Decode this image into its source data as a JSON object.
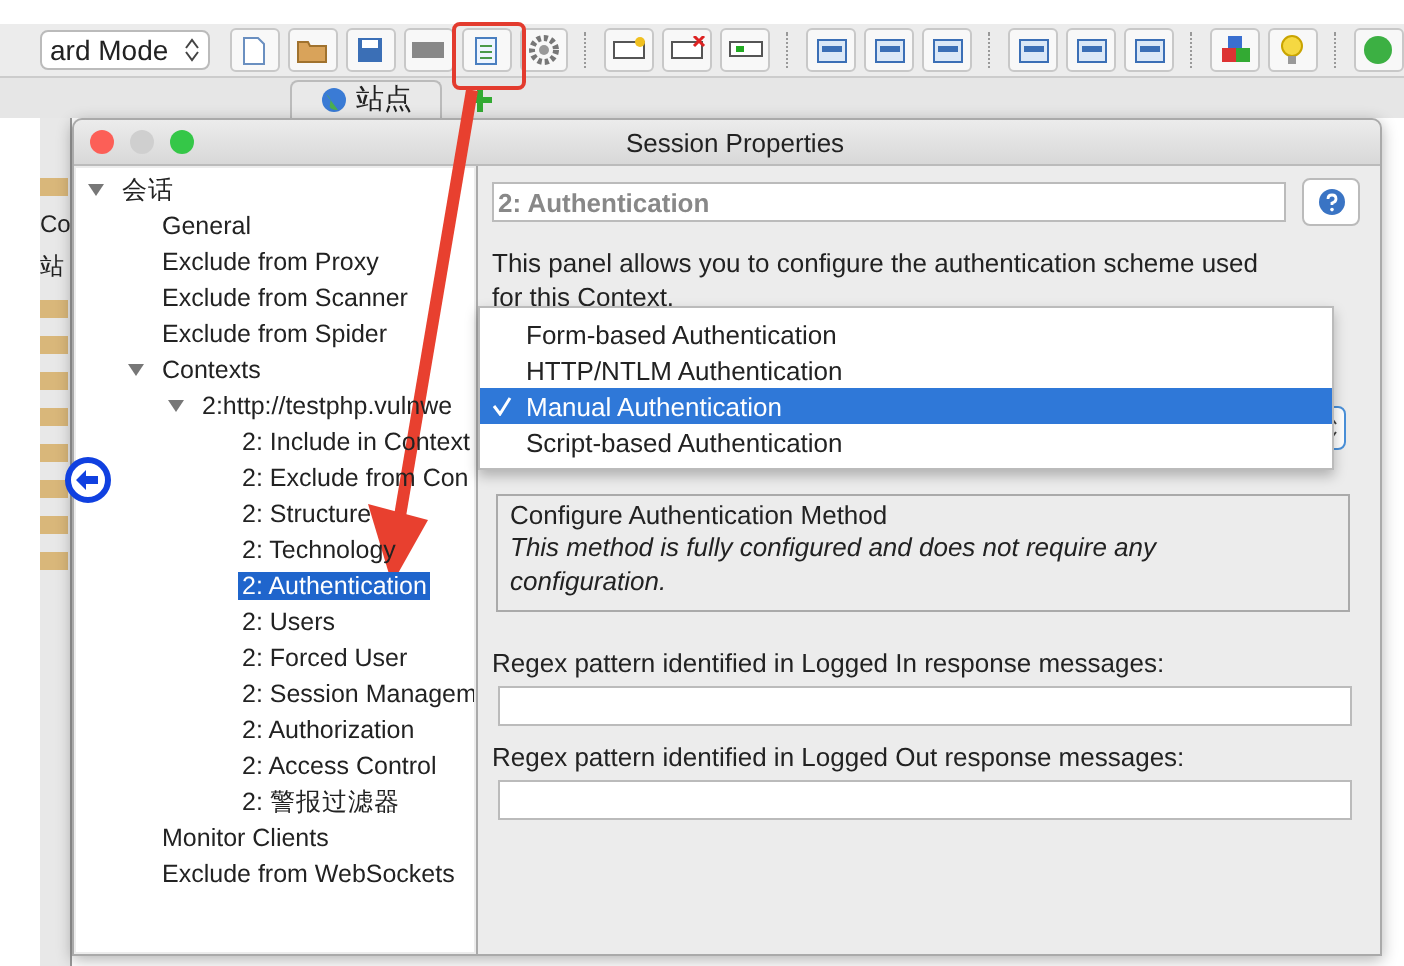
{
  "toolbar": {
    "mode": "ard Mode"
  },
  "tabs": [
    {
      "label": "站点",
      "selected": true
    }
  ],
  "side_panel": {
    "labels": [
      "Co",
      "站"
    ]
  },
  "dialog": {
    "title": "Session Properties",
    "tree": [
      {
        "label": "会话",
        "expanded": true,
        "selected": false,
        "children": [
          {
            "label": "General",
            "selected": false
          },
          {
            "label": "Exclude from Proxy",
            "selected": false
          },
          {
            "label": "Exclude from Scanner",
            "selected": false
          },
          {
            "label": "Exclude from Spider",
            "selected": false
          },
          {
            "label": "Contexts",
            "expanded": true,
            "selected": false,
            "children": [
              {
                "label": "2:http://testphp.vulnwe",
                "expanded": true,
                "selected": false,
                "children": [
                  {
                    "label": "2: Include in Context",
                    "selected": false
                  },
                  {
                    "label": "2: Exclude from Con",
                    "selected": false
                  },
                  {
                    "label": "2: Structure",
                    "selected": false
                  },
                  {
                    "label": "2: Technology",
                    "selected": false
                  },
                  {
                    "label": "2: Authentication",
                    "selected": true
                  },
                  {
                    "label": "2: Users",
                    "selected": false
                  },
                  {
                    "label": "2: Forced User",
                    "selected": false
                  },
                  {
                    "label": "2: Session Managem",
                    "selected": false
                  },
                  {
                    "label": "2: Authorization",
                    "selected": false
                  },
                  {
                    "label": "2: Access Control",
                    "selected": false
                  },
                  {
                    "label": "2: 警报过滤器",
                    "selected": false
                  }
                ]
              }
            ]
          },
          {
            "label": "Monitor Clients",
            "selected": false
          },
          {
            "label": "Exclude from WebSockets",
            "selected": false
          }
        ]
      }
    ],
    "panel": {
      "heading": "2: Authentication",
      "description": "This panel allows you to configure the authentication scheme used for this Context.",
      "method_options": [
        {
          "label": "Form-based Authentication",
          "selected": false
        },
        {
          "label": "HTTP/NTLM Authentication",
          "selected": false
        },
        {
          "label": "Manual Authentication",
          "selected": true
        },
        {
          "label": "Script-based Authentication",
          "selected": false
        }
      ],
      "config_group": {
        "title": "Configure Authentication Method",
        "message": "This method is fully configured and does not require any configuration."
      },
      "fields": [
        {
          "label": "Regex pattern identified in Logged In response messages:"
        },
        {
          "label": "Regex pattern identified in Logged Out response messages:"
        }
      ]
    }
  }
}
